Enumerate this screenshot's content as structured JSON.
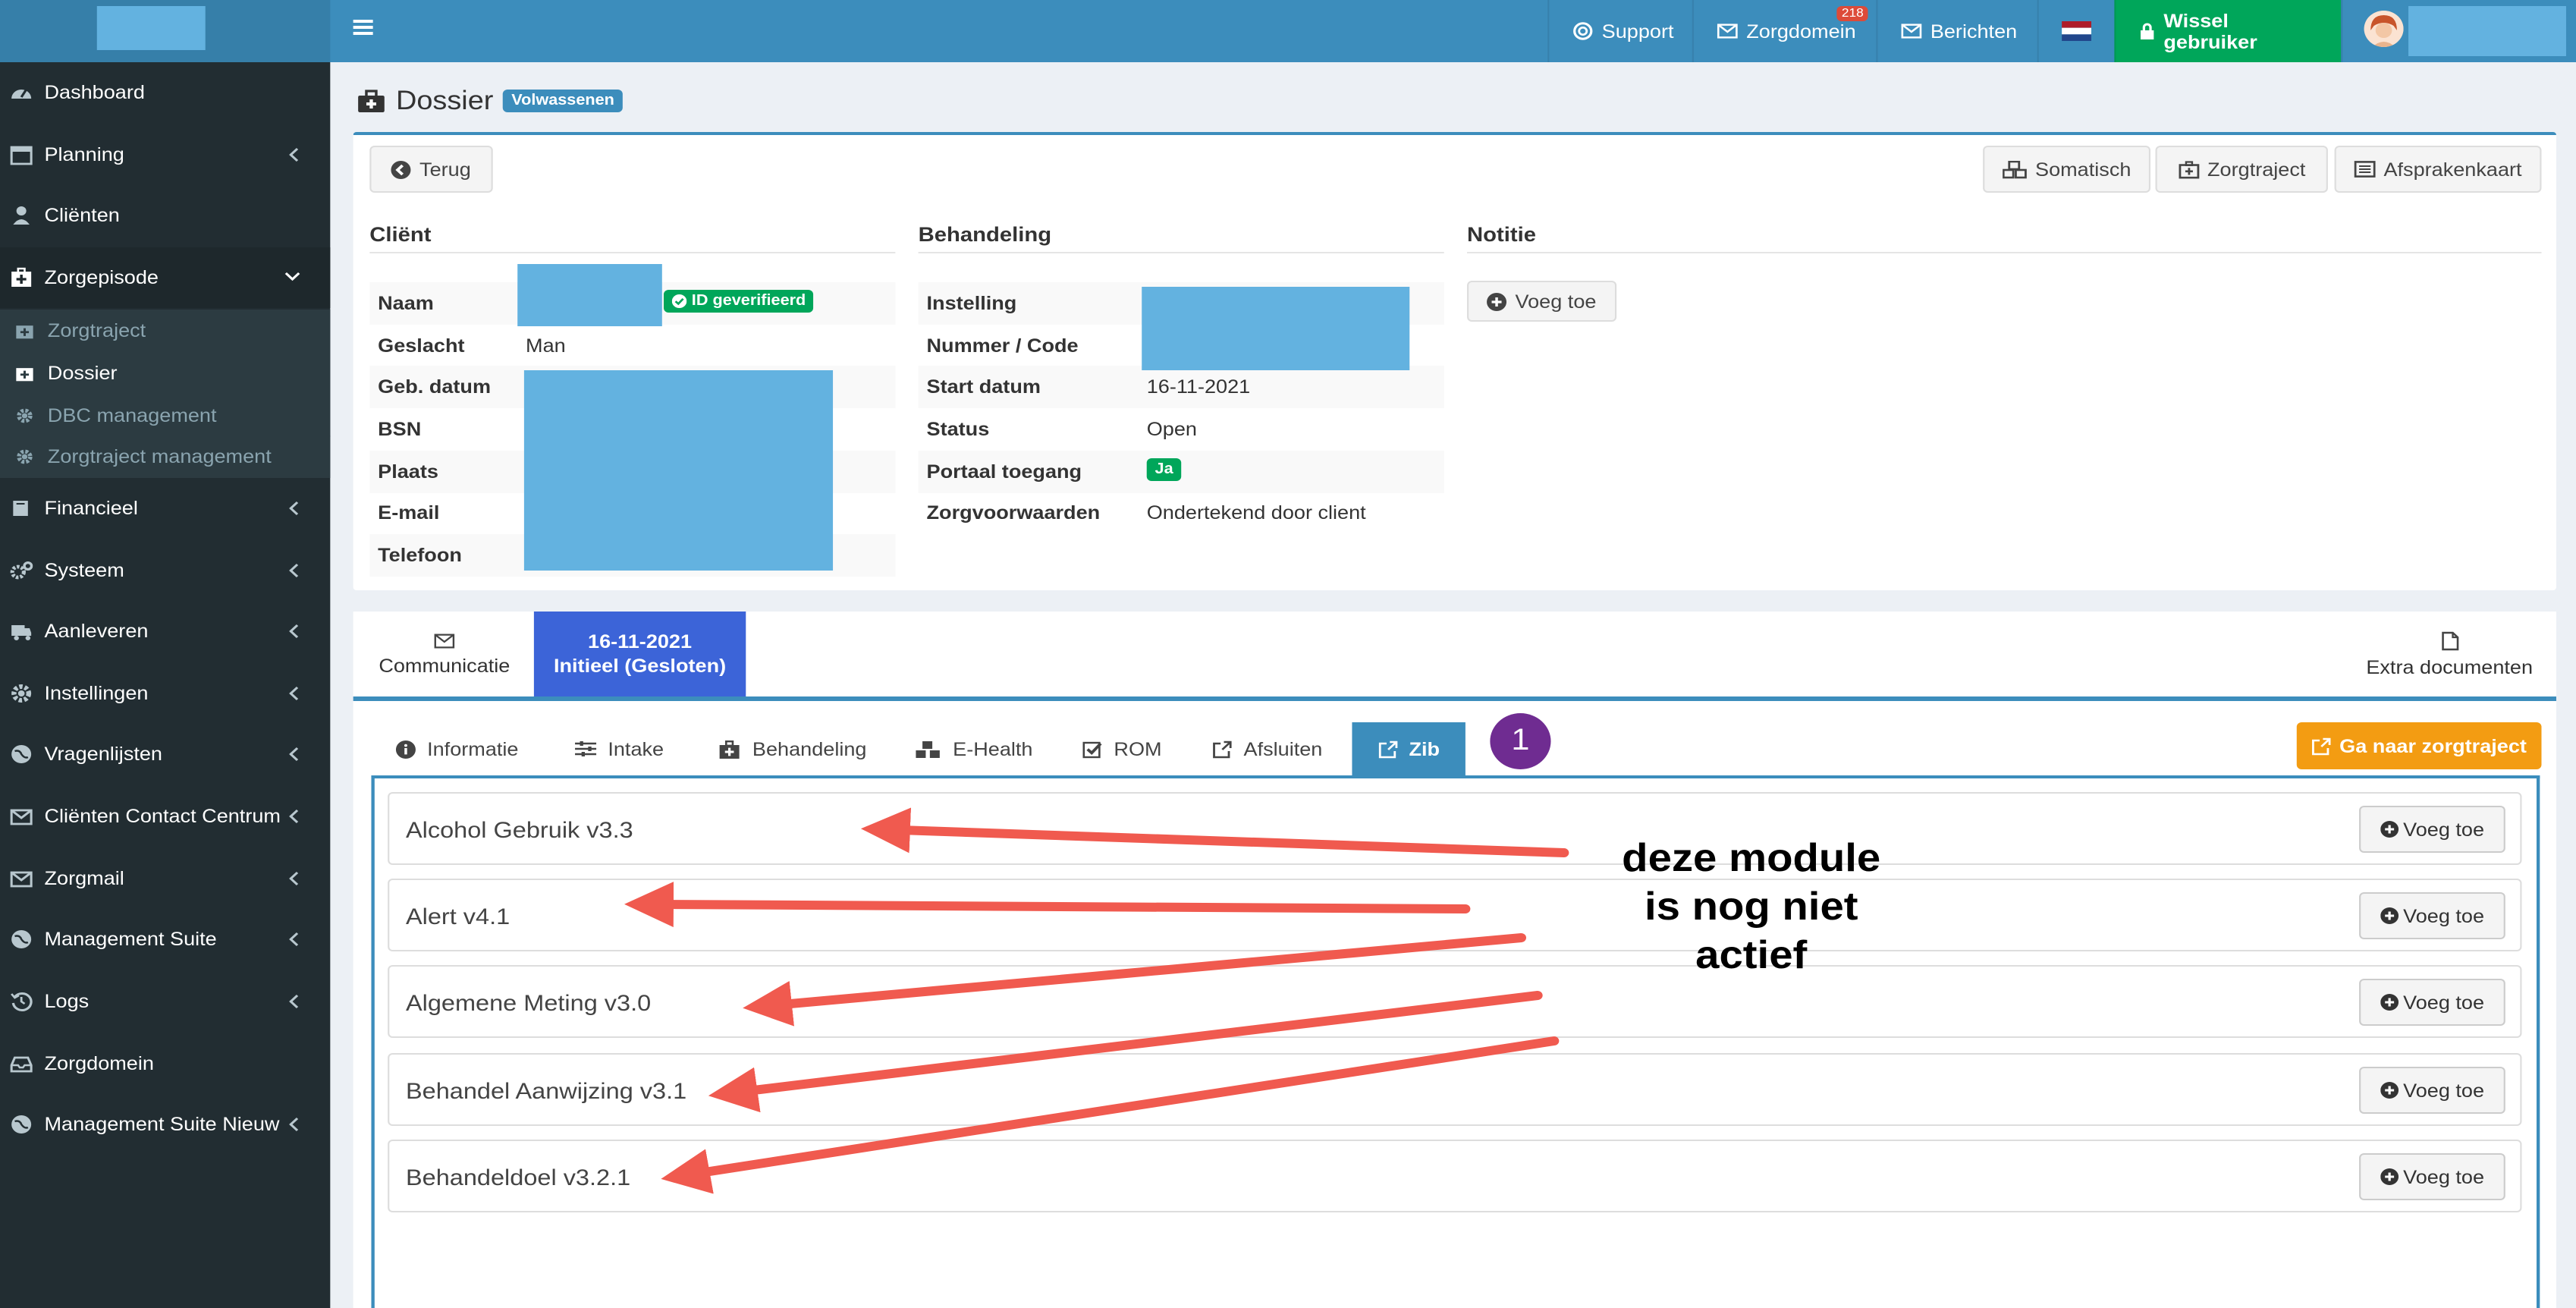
{
  "topbar": {
    "support": "Support",
    "zorgdomein": "Zorgdomein",
    "zorgdomein_badge": "218",
    "berichten": "Berichten",
    "wissel": "Wissel gebruiker"
  },
  "sidebar": {
    "items": [
      {
        "label": "Dashboard",
        "icon": "dashboard-icon"
      },
      {
        "label": "Planning",
        "icon": "calendar-icon"
      },
      {
        "label": "Cliënten",
        "icon": "user-icon"
      },
      {
        "label": "Zorgepisode",
        "icon": "medkit-icon"
      },
      {
        "label": "Financieel",
        "icon": "book-icon"
      },
      {
        "label": "Systeem",
        "icon": "gears-icon"
      },
      {
        "label": "Aanleveren",
        "icon": "truck-icon"
      },
      {
        "label": "Instellingen",
        "icon": "gear-icon"
      },
      {
        "label": "Vragenlijsten",
        "icon": "globe-icon"
      },
      {
        "label": "Cliënten Contact Centrum",
        "icon": "envelope-icon"
      },
      {
        "label": "Zorgmail",
        "icon": "envelope-icon"
      },
      {
        "label": "Management Suite",
        "icon": "globe-icon"
      },
      {
        "label": "Logs",
        "icon": "history-icon"
      },
      {
        "label": "Zorgdomein",
        "icon": "inbox-icon"
      },
      {
        "label": "Management Suite Nieuw",
        "icon": "globe-icon"
      }
    ],
    "subitems": [
      "Zorgtraject",
      "Dossier",
      "DBC management",
      "Zorgtraject management"
    ]
  },
  "page": {
    "title": "Dossier",
    "badge": "Volwassenen",
    "back": "Terug",
    "somatisch": "Somatisch",
    "zorgtraject": "Zorgtraject",
    "afsprakenkaart": "Afsprakenkaart"
  },
  "client": {
    "heading": "Cliënt",
    "labels": [
      "Naam",
      "Geslacht",
      "Geb. datum",
      "BSN",
      "Plaats",
      "E-mail",
      "Telefoon"
    ],
    "geslacht": "Man",
    "id_badge": "ID geverifieerd"
  },
  "behandeling": {
    "heading": "Behandeling",
    "labels": [
      "Instelling",
      "Nummer / Code",
      "Start datum",
      "Status",
      "Portaal toegang",
      "Zorgvoorwaarden"
    ],
    "start_datum": "16-11-2021",
    "status": "Open",
    "portaal": "Ja",
    "zorgvoorwaarden": "Ondertekend door client"
  },
  "notitie": {
    "heading": "Notitie",
    "add": "Voeg toe"
  },
  "tabs": {
    "communicatie": "Communicatie",
    "date": "16-11-2021",
    "status": "Initieel (Gesloten)",
    "extra": "Extra documenten"
  },
  "subtabs": [
    "Informatie",
    "Intake",
    "Behandeling",
    "E-Health",
    "ROM",
    "Afsluiten",
    "Zib"
  ],
  "step_number": "1",
  "goto_zorgtraject": "Ga naar zorgtraject",
  "zib_modules": [
    "Alcohol Gebruik v3.3",
    "Alert v4.1",
    "Algemene Meting v3.0",
    "Behandel Aanwijzing v3.1",
    "Behandeldoel v3.2.1"
  ],
  "zib_add": "Voeg toe",
  "annotation": [
    "deze module",
    "is nog niet",
    "actief"
  ],
  "colors": {
    "header": "#3c8dbc",
    "sidebar": "#222d32",
    "arrow": "#f05a4f",
    "wissel": "#00a65a",
    "orange": "#f39c12"
  }
}
